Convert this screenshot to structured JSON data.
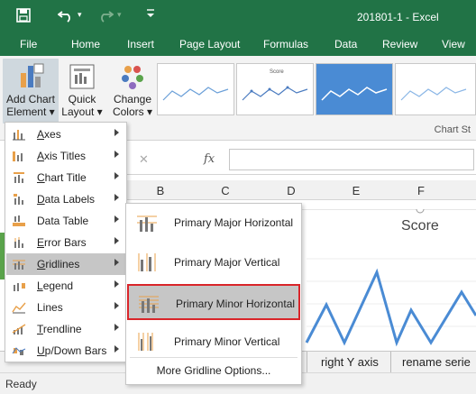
{
  "window": {
    "title": "201801-1 - Excel"
  },
  "tabs": [
    "File",
    "Home",
    "Insert",
    "Page Layout",
    "Formulas",
    "Data",
    "Review",
    "View"
  ],
  "ribbon": {
    "add_chart_element": [
      "Add Chart",
      "Element"
    ],
    "quick_layout": [
      "Quick",
      "Layout"
    ],
    "change_colors": [
      "Change",
      "Colors"
    ],
    "group_label": "Chart St",
    "style_titles": [
      "Score"
    ]
  },
  "formula_bar": {
    "fx_label": "fx",
    "cancel_label": "✕",
    "value": ""
  },
  "columns": [
    "B",
    "C",
    "D",
    "E",
    "F"
  ],
  "chart": {
    "title": "Score"
  },
  "menu": {
    "items": [
      {
        "label": "Axes",
        "underline": "A",
        "rest": "xes"
      },
      {
        "label": "Axis Titles",
        "underline": "A",
        "rest": "xis Titles"
      },
      {
        "label": "Chart Title",
        "underline": "C",
        "rest": "hart Title"
      },
      {
        "label": "Data Labels",
        "underline": "D",
        "rest": "ata Labels"
      },
      {
        "label": "Data Table",
        "underline": "B",
        "rest": ""
      },
      {
        "label": "Error Bars",
        "underline": "E",
        "rest": "rror Bars"
      },
      {
        "label": "Gridlines",
        "underline": "G",
        "rest": "ridlines"
      },
      {
        "label": "Legend",
        "underline": "L",
        "rest": "egend"
      },
      {
        "label": "Lines",
        "underline": "I",
        "rest": ""
      },
      {
        "label": "Trendline",
        "underline": "T",
        "rest": "rendline"
      },
      {
        "label": "Up/Down Bars",
        "underline": "U",
        "rest": "p/Down Bars"
      }
    ],
    "highlighted": "Gridlines"
  },
  "submenu": {
    "items": [
      "Primary Major Horizontal",
      "Primary Major Vertical",
      "Primary Minor Horizontal",
      "Primary Minor Vertical"
    ],
    "selected": "Primary Minor Horizontal",
    "more_options": "More Gridline Options..."
  },
  "sheet_tabs": [
    "right Y axis",
    "rename serie"
  ],
  "status": {
    "text": "Ready"
  },
  "colors": {
    "excel_green": "#217346",
    "highlight": "#c6c6c6",
    "selected_border": "#d9252a",
    "chart_line": "#4a8bd4"
  }
}
